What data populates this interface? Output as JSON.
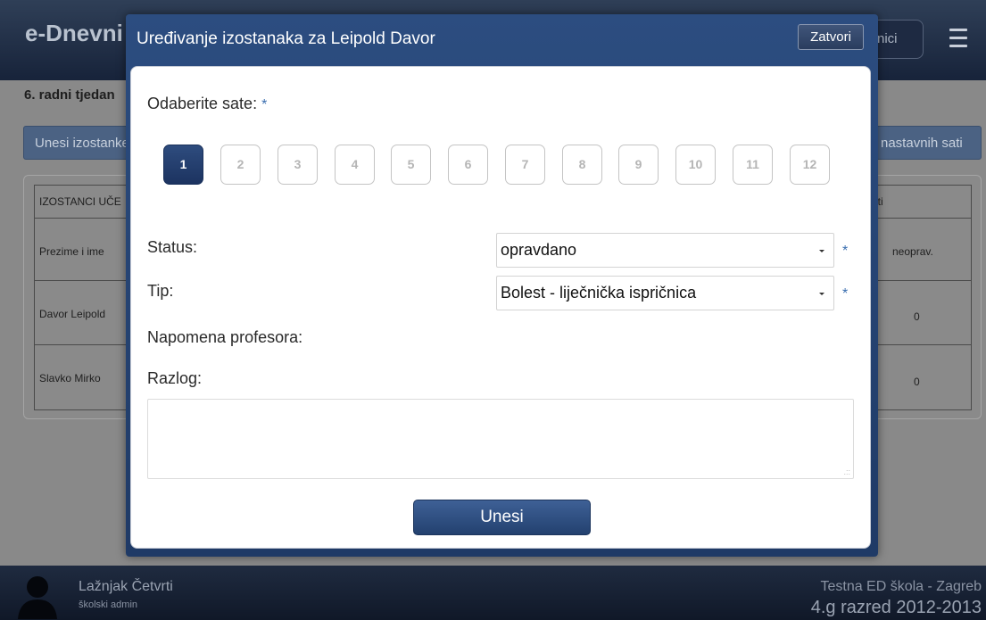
{
  "app": {
    "brand": "e-Dnevni",
    "top_pill": "nici",
    "week_title": "6. radni tjedan",
    "enter_button": "Unesi izostanke",
    "hours_button": "nastavnih sati",
    "table": {
      "header_left": "IZOSTANCI UČE",
      "header_right": "ati",
      "col_name": "Prezime i ime",
      "col_unexcused": "neoprav.",
      "rows": [
        {
          "name": "Davor Leipold",
          "unexcused": "0"
        },
        {
          "name": "Slavko Mirko",
          "unexcused": "0"
        }
      ]
    }
  },
  "footer": {
    "user_name": "Lažnjak Četvrti",
    "user_role": "školski admin",
    "school": "Testna ED škola - Zagreb",
    "class_name": "4.g razred 2012-2013"
  },
  "modal": {
    "title": "Uređivanje izostanaka za Leipold Davor",
    "close_label": "Zatvori",
    "select_hours_label": "Odaberite sate:",
    "required_mark": "*",
    "hours": [
      "1",
      "2",
      "3",
      "4",
      "5",
      "6",
      "7",
      "8",
      "9",
      "10",
      "11",
      "12"
    ],
    "selected_hour": "1",
    "status_label": "Status:",
    "status_value": "opravdano",
    "type_label": "Tip:",
    "type_value": "Bolest - liječnička ispričnica",
    "teacher_note_label": "Napomena profesora:",
    "reason_label": "Razlog:",
    "reason_value": "",
    "submit_label": "Unesi"
  },
  "colors": {
    "modal_header": "#2c4d80",
    "active_hour": "#1c3360",
    "required": "#3b6fb0"
  }
}
